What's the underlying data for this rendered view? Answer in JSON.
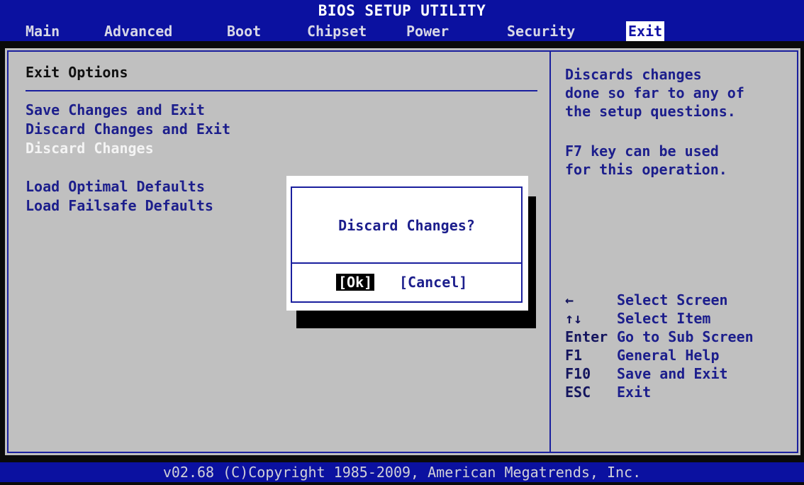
{
  "header": {
    "title": "BIOS SETUP UTILITY"
  },
  "menu": {
    "tabs": [
      "Main",
      "Advanced",
      "Boot",
      "Chipset",
      "Power",
      "Security",
      "Exit"
    ],
    "active": "Exit"
  },
  "main": {
    "section_title": "Exit Options",
    "options": [
      {
        "label": "Save Changes and Exit"
      },
      {
        "label": "Discard Changes and Exit"
      },
      {
        "label": "Discard Changes",
        "selected": true
      },
      {
        "label": "Load Optimal Defaults"
      },
      {
        "label": "Load Failsafe Defaults"
      }
    ]
  },
  "help": {
    "description_lines": [
      "Discards changes",
      "done so far to any of",
      "the setup questions."
    ],
    "hint_lines": [
      "F7 key can be used",
      "for this operation."
    ],
    "keys": [
      {
        "key": "←",
        "action": "Select Screen",
        "icon": "arrow-left-icon"
      },
      {
        "key": "↑↓",
        "action": "Select Item",
        "icon": "arrow-up-down-icon"
      },
      {
        "key": "Enter",
        "action": "Go to Sub Screen"
      },
      {
        "key": "F1",
        "action": "General Help"
      },
      {
        "key": "F10",
        "action": "Save and Exit"
      },
      {
        "key": "ESC",
        "action": "Exit"
      }
    ]
  },
  "dialog": {
    "message": "Discard Changes?",
    "ok_label": "[Ok]",
    "cancel_label": "[Cancel]"
  },
  "footer": {
    "text": "v02.68 (C)Copyright 1985-2009, American Megatrends, Inc."
  },
  "colors": {
    "bar_blue": "#0b11a0",
    "panel_gray": "#c0c0c0",
    "text_blue": "#1c1e8c",
    "selected_white": "#f4f4f4"
  }
}
